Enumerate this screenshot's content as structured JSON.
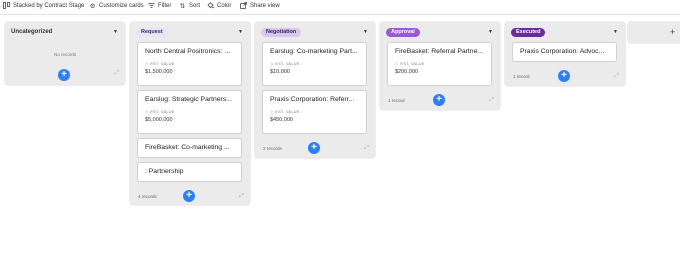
{
  "toolbar": {
    "stack_label": "Stacked by Contract Stage",
    "customize_label": "Customize cards",
    "filter_label": "Filter",
    "sort_label": "Sort",
    "color_label": "Color",
    "share_label": "Share view"
  },
  "colors": {
    "accent": "#2d7ff9",
    "request_badge_bg": "#e8e4f6",
    "negotiation_badge_bg": "#d9c6ec",
    "approval_badge_bg": "#9b59d6",
    "executed_badge_bg": "#6b2aa0"
  },
  "columns": [
    {
      "name": "Uncategorized",
      "empty_text": "No records",
      "footer_text": ""
    },
    {
      "name": "Request",
      "footer_text": "4 records",
      "cards": [
        {
          "title": "North Central Positronics: ...",
          "field_label": "EST. VALUE",
          "value": "$1,500,000"
        },
        {
          "title": "Earslug: Strategic Partners...",
          "field_label": "EST. VALUE",
          "value": "$5,000,000"
        },
        {
          "title": "FireBasket: Co-marketing ..."
        },
        {
          "title": ": Partnership"
        }
      ]
    },
    {
      "name": "Negotiation",
      "footer_text": "2 records",
      "cards": [
        {
          "title": "Earslug: Co-marketing Part...",
          "field_label": "EST. VALUE",
          "value": "$10,000"
        },
        {
          "title": "Praxis Corporation: Referr...",
          "field_label": "EST. VALUE",
          "value": "$450,000"
        }
      ]
    },
    {
      "name": "Approval",
      "footer_text": "1 record",
      "cards": [
        {
          "title": "FireBasket: Referral Partne...",
          "field_label": "EST. VALUE",
          "value": "$200,000"
        }
      ]
    },
    {
      "name": "Executed",
      "footer_text": "1 record",
      "cards": [
        {
          "title": "Praxis Corporation: Advoc..."
        }
      ]
    }
  ],
  "add_stack_icon": "plus"
}
